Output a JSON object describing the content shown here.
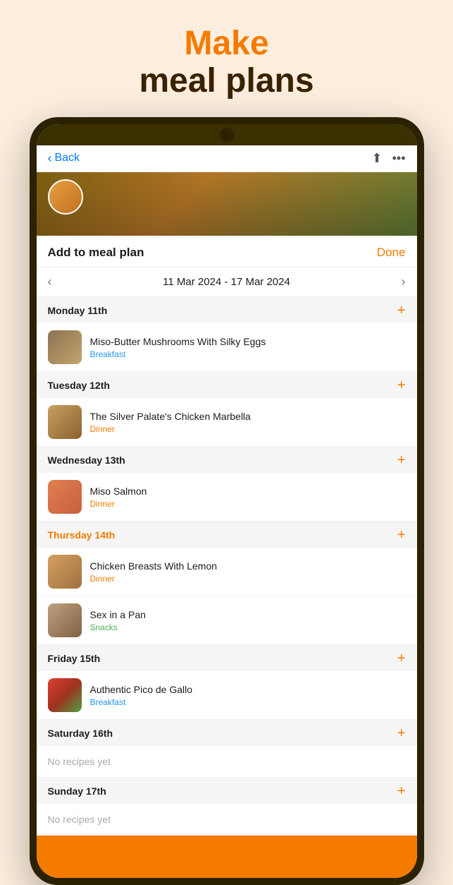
{
  "header": {
    "make": "Make",
    "meal_plans": "meal plans"
  },
  "nav": {
    "back_label": "Back",
    "done_label": "Done",
    "modal_title": "Add to meal plan",
    "week_range": "11 Mar 2024 - 17 Mar 2024"
  },
  "days": [
    {
      "id": "monday",
      "label": "Monday 11th",
      "highlight": false,
      "recipes": [
        {
          "name": "Miso-Butter Mushrooms With Silky Eggs",
          "tag": "Breakfast",
          "tag_class": "tag-breakfast",
          "thumb_class": "thumb-mushroom"
        }
      ]
    },
    {
      "id": "tuesday",
      "label": "Tuesday 12th",
      "highlight": false,
      "recipes": [
        {
          "name": "The Silver Palate's Chicken Marbella",
          "tag": "Dinner",
          "tag_class": "tag-dinner",
          "thumb_class": "thumb-chicken"
        }
      ]
    },
    {
      "id": "wednesday",
      "label": "Wednesday 13th",
      "highlight": false,
      "recipes": [
        {
          "name": "Miso Salmon",
          "tag": "Dinner",
          "tag_class": "tag-dinner",
          "thumb_class": "thumb-salmon"
        }
      ]
    },
    {
      "id": "thursday",
      "label": "Thursday 14th",
      "highlight": true,
      "recipes": [
        {
          "name": "Chicken Breasts With Lemon",
          "tag": "Dinner",
          "tag_class": "tag-dinner",
          "thumb_class": "thumb-breast"
        },
        {
          "name": "Sex in a Pan",
          "tag": "Snacks",
          "tag_class": "tag-snacks",
          "thumb_class": "thumb-sexinpan"
        }
      ]
    },
    {
      "id": "friday",
      "label": "Friday 15th",
      "highlight": false,
      "recipes": [
        {
          "name": "Authentic Pico de Gallo",
          "tag": "Breakfast",
          "tag_class": "tag-breakfast",
          "thumb_class": "thumb-pico"
        }
      ]
    },
    {
      "id": "saturday",
      "label": "Saturday 16th",
      "highlight": false,
      "recipes": []
    },
    {
      "id": "sunday",
      "label": "Sunday 17th",
      "highlight": false,
      "recipes": []
    }
  ],
  "no_recipes_label": "No recipes yet",
  "colors": {
    "orange": "#f47b00",
    "dark_brown": "#3a2200"
  }
}
